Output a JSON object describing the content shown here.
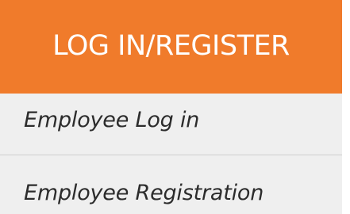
{
  "header": {
    "title": "LOG IN/REGISTER"
  },
  "menu": {
    "items": [
      {
        "label": "Employee Log in"
      },
      {
        "label": "Employee Registration"
      }
    ]
  },
  "colors": {
    "header_background": "#f07b2b",
    "header_text": "#ffffff",
    "menu_background": "#efefef",
    "menu_text": "#2c2c2c",
    "divider": "#cfcfcf"
  }
}
